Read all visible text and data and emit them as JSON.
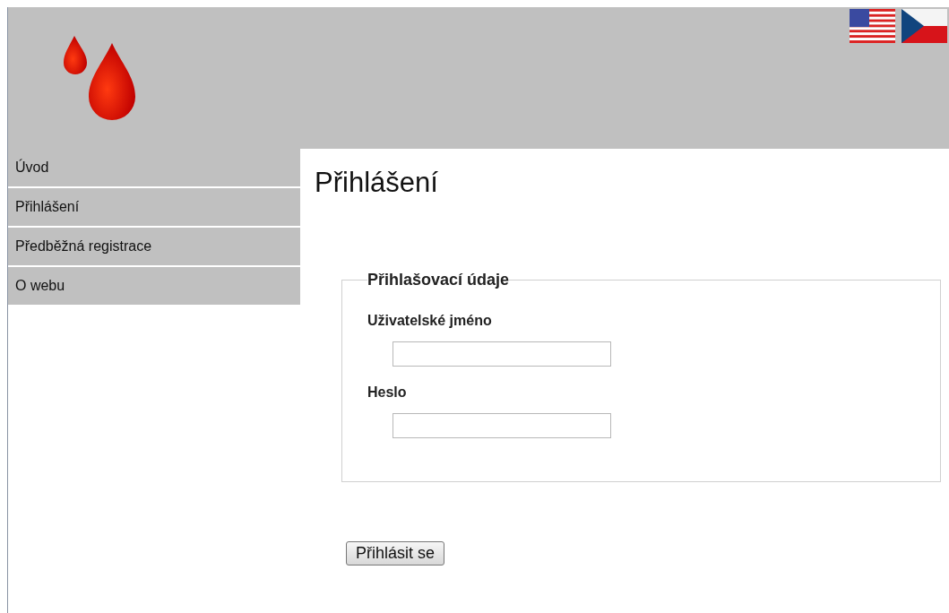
{
  "menu": [
    {
      "label": "Úvod"
    },
    {
      "label": "Přihlášení"
    },
    {
      "label": "Předběžná registrace"
    },
    {
      "label": "O webu"
    }
  ],
  "title": "Přihlášení",
  "fieldset": {
    "legend": "Přihlašovací údaje",
    "fields": [
      {
        "label": "Uživatelské jméno"
      },
      {
        "label": "Heslo"
      }
    ]
  },
  "submit": "Přihlásit se"
}
